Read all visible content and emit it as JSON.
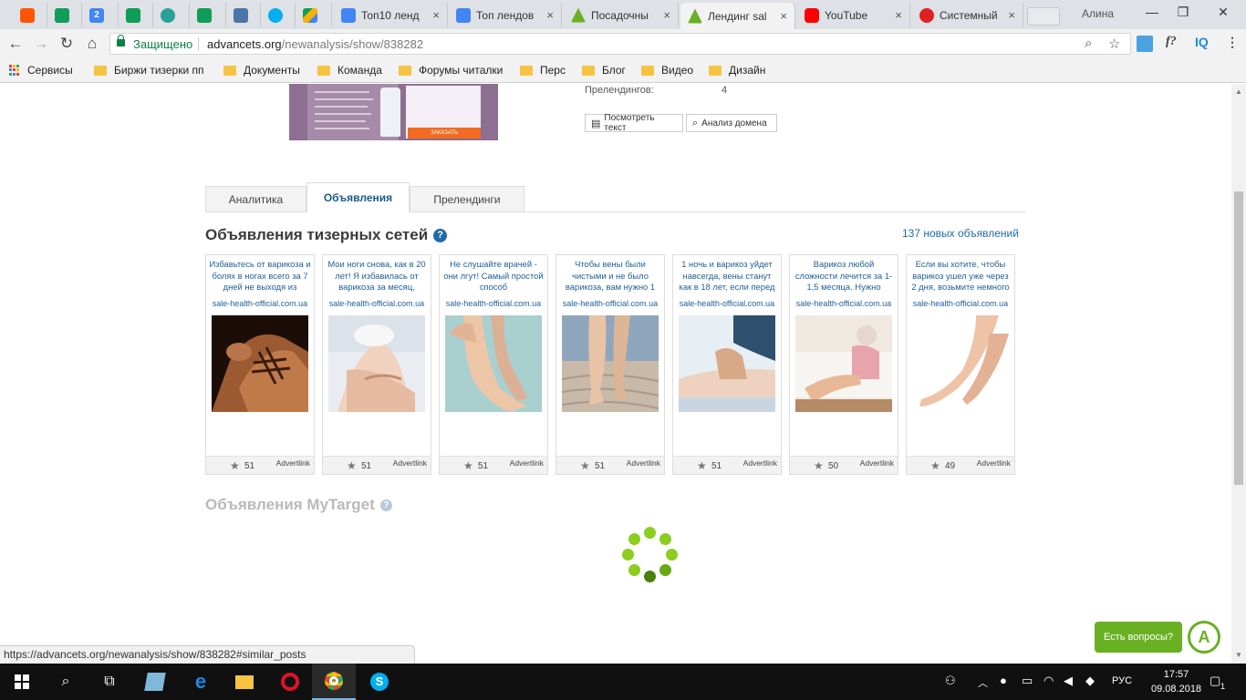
{
  "browser": {
    "tabs": [
      {
        "title": "",
        "favicon": "soundcloud-icon",
        "color": "#ff5500"
      },
      {
        "title": "",
        "favicon": "sheets-icon",
        "color": "#0f9d58"
      },
      {
        "title": "2",
        "favicon": "calendar-icon",
        "color": "#4285f4"
      },
      {
        "title": "",
        "favicon": "sheets-icon",
        "color": "#0f9d58"
      },
      {
        "title": "",
        "favicon": "app-icon",
        "color": "#2aa198"
      },
      {
        "title": "",
        "favicon": "sheets-icon",
        "color": "#0f9d58"
      },
      {
        "title": "",
        "favicon": "vk-icon",
        "color": "#4a76a8"
      },
      {
        "title": "",
        "favicon": "skype-icon",
        "color": "#00aff0"
      },
      {
        "title": "",
        "favicon": "drive-icon",
        "color": "#f4b400"
      },
      {
        "title": "Топ10 ленд",
        "favicon": "docs-icon",
        "color": "#4285f4"
      },
      {
        "title": "Топ лендов",
        "favicon": "docs-icon",
        "color": "#4285f4"
      },
      {
        "title": "Посадочны",
        "favicon": "advancets-icon",
        "color": "#6ab023"
      },
      {
        "title": "Лендинг sal",
        "favicon": "advancets-icon",
        "color": "#6ab023"
      },
      {
        "title": "YouTube",
        "favicon": "youtube-icon",
        "color": "#ff0000"
      },
      {
        "title": "Системный",
        "favicon": "app-icon",
        "color": "#e02020"
      }
    ],
    "user": "Алина",
    "secure_label": "Защищено",
    "url_host": "advancets.org",
    "url_path": "/newanalysis/show/838282",
    "extensions": [
      "f?",
      "IQ"
    ]
  },
  "bookmarks": [
    {
      "label": "Сервисы"
    },
    {
      "label": "Биржи тизерки пп"
    },
    {
      "label": "Документы"
    },
    {
      "label": "Команда"
    },
    {
      "label": "Форумы читалки"
    },
    {
      "label": "Перс"
    },
    {
      "label": "Блог"
    },
    {
      "label": "Видео"
    },
    {
      "label": "Дизайн"
    }
  ],
  "landing": {
    "prelandings_label": "Прелендингов:",
    "prelandings_value": "4",
    "view_text_button": "Посмотреть текст",
    "domain_analysis_button": "Анализ домена",
    "thumb_order_button": "ЗАКАЗАТЬ"
  },
  "page_tabs": [
    {
      "label": "Аналитика"
    },
    {
      "label": "Объявления"
    },
    {
      "label": "Прелендинги"
    }
  ],
  "teaser_section": {
    "title": "Объявления тизерных сетей",
    "new_ads_link": "137 новых объявлений",
    "help": "?"
  },
  "ads": [
    {
      "text": "Избавьтесь от варикоза и болях в ногах всего за 7 дней не выходя из",
      "domain": "sale-health-official.com.ua",
      "rating": "51",
      "network": "Advertlink"
    },
    {
      "text": "Мои ноги снова, как в 20 лет! Я избавилась от варикоза за месяц,",
      "domain": "sale-health-official.com.ua",
      "rating": "51",
      "network": "Advertlink"
    },
    {
      "text": "Не слушайте врачей - они лгут! Самый простой способ",
      "domain": "sale-health-official.com.ua",
      "rating": "51",
      "network": "Advertlink"
    },
    {
      "text": "Чтобы вены были чистыми и не было варикоза, вам нужно 1",
      "domain": "sale-health-official.com.ua",
      "rating": "51",
      "network": "Advertlink"
    },
    {
      "text": "1 ночь и варикоз уйдет навсегда, вены станут как в 18 лет, если перед",
      "domain": "sale-health-official.com.ua",
      "rating": "51",
      "network": "Advertlink"
    },
    {
      "text": "Варикоз любой сложности лечится за 1-1,5 месяца. Нужно",
      "domain": "sale-health-official.com.ua",
      "rating": "50",
      "network": "Advertlink"
    },
    {
      "text": "Если вы хотите, чтобы варикоз ушел уже через 2 дня, возьмите немного",
      "domain": "sale-health-official.com.ua",
      "rating": "49",
      "network": "Advertlink"
    }
  ],
  "mytarget_section": {
    "title": "Объявления MyTarget",
    "help": "?"
  },
  "status_url": "https://advancets.org/newanalysis/show/838282#similar_posts",
  "help_widget": {
    "label": "Есть вопросы?",
    "logo": "A"
  },
  "taskbar": {
    "language": "РУС",
    "time": "17:57",
    "date": "09.08.2018",
    "notifications": "1"
  }
}
